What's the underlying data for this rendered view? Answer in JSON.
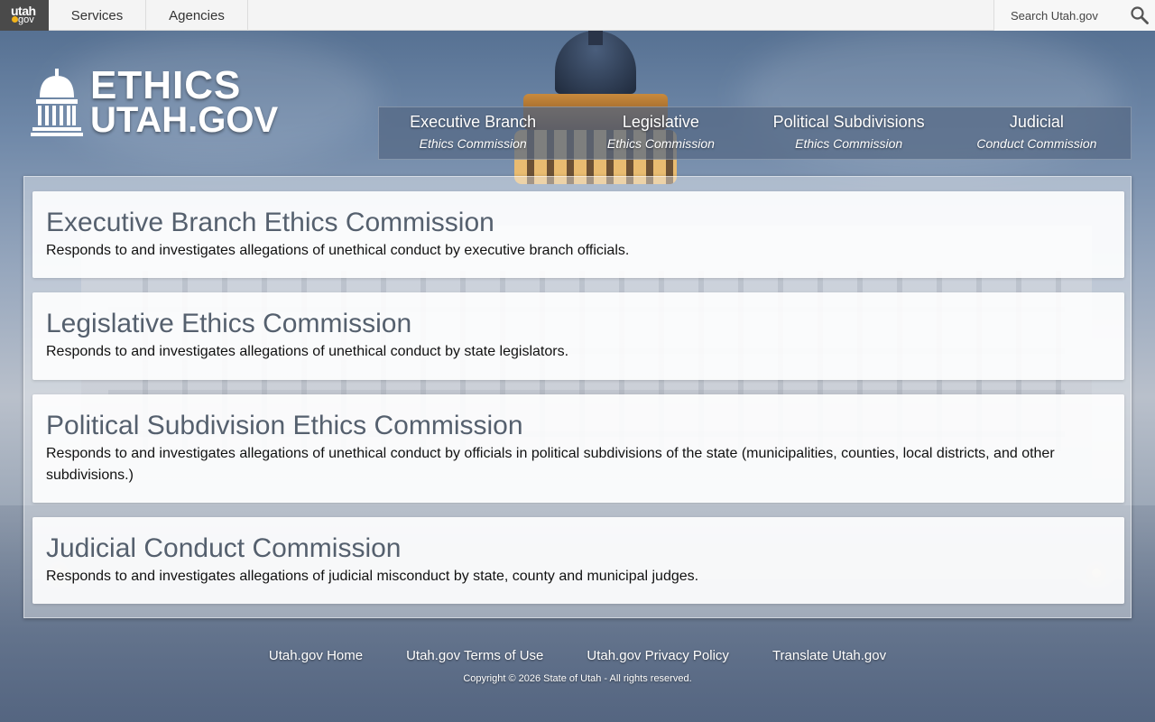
{
  "topbar": {
    "logo_line1": "utah",
    "logo_line2": "gov",
    "nav": [
      "Services",
      "Agencies"
    ],
    "search_placeholder": "Search Utah.gov"
  },
  "header": {
    "brand_line1": "ETHICS",
    "brand_line2": "UTAH.GOV",
    "branches": [
      {
        "title": "Executive Branch",
        "subtitle": "Ethics Commission"
      },
      {
        "title": "Legislative",
        "subtitle": "Ethics Commission"
      },
      {
        "title": "Political Subdivisions",
        "subtitle": "Ethics Commission"
      },
      {
        "title": "Judicial",
        "subtitle": "Conduct Commission"
      }
    ]
  },
  "cards": [
    {
      "title": "Executive Branch Ethics Commission",
      "text": "Responds to and investigates allegations of unethical conduct by executive branch officials."
    },
    {
      "title": "Legislative Ethics Commission",
      "text": "Responds to and investigates allegations of unethical conduct by state legislators."
    },
    {
      "title": "Political Subdivision Ethics Commission",
      "text": "Responds to and investigates allegations of unethical conduct by officials in political subdivisions of the state (municipalities, counties, local districts, and other subdivisions.)"
    },
    {
      "title": "Judicial Conduct Commission",
      "text": "Responds to and investigates allegations of judicial misconduct by state, county and municipal judges."
    }
  ],
  "footer": {
    "links": [
      "Utah.gov Home",
      "Utah.gov Terms of Use",
      "Utah.gov Privacy Policy",
      "Translate Utah.gov"
    ],
    "copyright": "Copyright © 2026 State of Utah - All rights reserved."
  },
  "colors": {
    "accent_logo_dot": "#f2b319",
    "card_title": "#55606e",
    "nav_bar": "#546884"
  },
  "icons": [
    "search-icon",
    "capitol-icon"
  ]
}
